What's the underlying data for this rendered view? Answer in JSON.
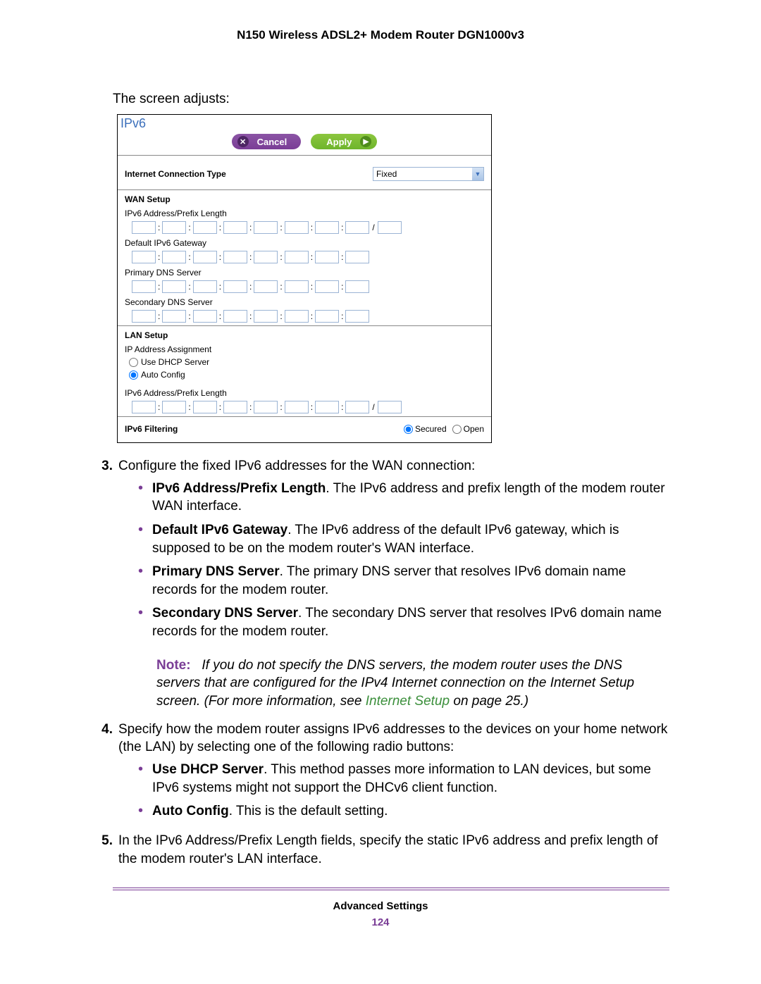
{
  "header": {
    "title": "N150 Wireless ADSL2+ Modem Router DGN1000v3"
  },
  "lead": "The screen adjusts:",
  "shot": {
    "title": "IPv6",
    "cancel": "Cancel",
    "apply": "Apply",
    "ict_label": "Internet Connection Type",
    "ict_value": "Fixed",
    "wan_setup": "WAN Setup",
    "ipv6_addr_label": "IPv6 Address/Prefix Length",
    "default_gw": "Default IPv6 Gateway",
    "primary_dns": "Primary DNS Server",
    "secondary_dns": "Secondary DNS Server",
    "lan_setup": "LAN Setup",
    "ip_assign": "IP Address Assignment",
    "use_dhcp": "Use DHCP Server",
    "auto_config": "Auto Config",
    "lan_ipv6_addr": "IPv6 Address/Prefix Length",
    "ipv6_filtering": "IPv6 Filtering",
    "secured": "Secured",
    "open": "Open"
  },
  "steps": {
    "s3": {
      "num": "3.",
      "text": "Configure the fixed IPv6 addresses for the WAN connection:",
      "items": [
        {
          "bold": "IPv6 Address/Prefix Length",
          "rest": ". The IPv6 address and prefix length of the modem router WAN interface."
        },
        {
          "bold": "Default IPv6 Gateway",
          "rest": ". The IPv6 address of the default IPv6 gateway, which is supposed to be on the modem router's WAN interface."
        },
        {
          "bold": "Primary DNS Server",
          "rest": ". The primary DNS server that resolves IPv6 domain name records for the modem router."
        },
        {
          "bold": "Secondary DNS Server",
          "rest": ". The secondary DNS server that resolves IPv6 domain name records for the modem router."
        }
      ]
    },
    "note": {
      "label": "Note:",
      "body_a": "If you do not specify the DNS servers, the modem router uses the DNS servers that are configured for the IPv4 Internet connection on the Internet Setup screen. (For more information, see ",
      "link": "Internet Setup",
      "body_b": " on page 25.)"
    },
    "s4": {
      "num": "4.",
      "text": "Specify how the modem router assigns IPv6 addresses to the devices on your home network (the LAN) by selecting one of the following radio buttons:",
      "items": [
        {
          "bold": "Use DHCP Server",
          "rest": ". This method passes more information to LAN devices, but some IPv6 systems might not support the DHCv6 client function."
        },
        {
          "bold": "Auto Config",
          "rest": ". This is the default setting."
        }
      ]
    },
    "s5": {
      "num": "5.",
      "text": "In the IPv6 Address/Prefix Length fields, specify the static IPv6 address and prefix length of the modem router's LAN interface."
    }
  },
  "footer": {
    "title": "Advanced Settings",
    "page": "124"
  }
}
